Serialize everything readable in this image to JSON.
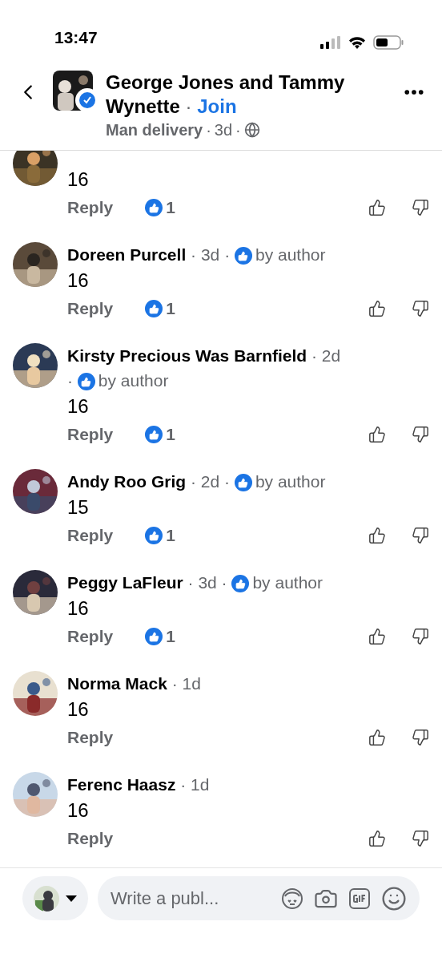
{
  "status_bar": {
    "time": "13:47"
  },
  "separator": "·",
  "header": {
    "title": "George Jones and Tammy Wynette",
    "join": "Join",
    "post_author": "Man delivery",
    "post_time": "3d"
  },
  "comments": [
    {
      "text": "16",
      "reply": "Reply",
      "likes": "1"
    },
    {
      "name": "Doreen Purcell",
      "time": "3d",
      "by_author": true,
      "by_author_label": "by author",
      "text": "16",
      "reply": "Reply",
      "likes": "1"
    },
    {
      "name": "Kirsty Precious Was Barnfield",
      "time": "2d",
      "by_author": true,
      "by_author_label": "by author",
      "text": "16",
      "reply": "Reply",
      "likes": "1"
    },
    {
      "name": "Andy Roo Grig",
      "time": "2d",
      "by_author": true,
      "by_author_label": "by author",
      "text": "15",
      "reply": "Reply",
      "likes": "1"
    },
    {
      "name": "Peggy LaFleur",
      "time": "3d",
      "by_author": true,
      "by_author_label": "by author",
      "text": "16",
      "reply": "Reply",
      "likes": "1"
    },
    {
      "name": "Norma Mack",
      "time": "1d",
      "by_author": false,
      "text": "16",
      "reply": "Reply"
    },
    {
      "name": "Ferenc Haasz",
      "time": "1d",
      "by_author": false,
      "text": "16",
      "reply": "Reply"
    }
  ],
  "composer": {
    "placeholder": "Write a publ..."
  }
}
